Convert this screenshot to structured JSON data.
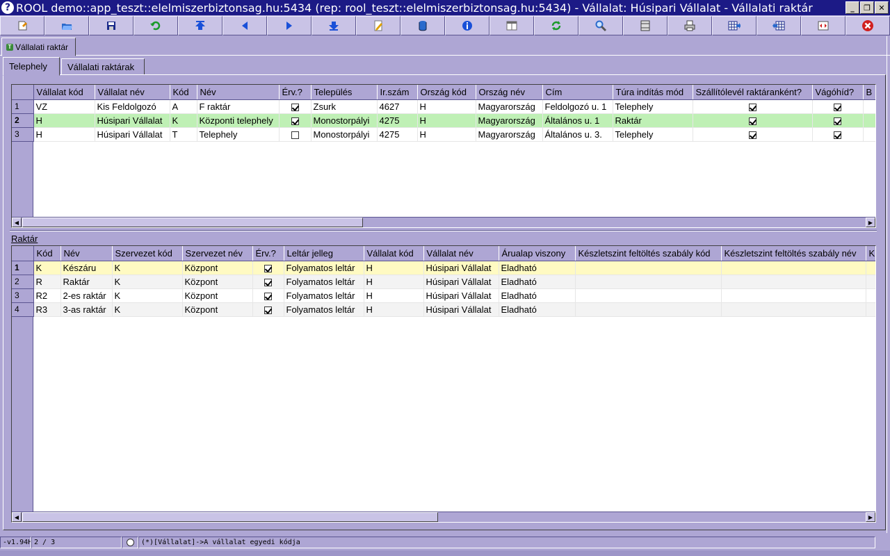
{
  "window": {
    "title": "ROOL demo::app_teszt::elelmiszerbiztonsag.hu:5434 (rep: rool_teszt::elelmiszerbiztonsag.hu:5434) - Vállalat: Húsipari Vállalat - Vállalati raktár",
    "app_icon_glyph": "?",
    "minimize": "_",
    "restore": "❐",
    "close": "✕"
  },
  "toolbar": {
    "buttons": [
      {
        "name": "new-icon",
        "color": "#e08a00"
      },
      {
        "name": "open-folder-icon",
        "color": "#2a6acc"
      },
      {
        "name": "save-icon",
        "color": "#1a2a8a"
      },
      {
        "name": "undo-icon",
        "color": "#1a9a2a"
      },
      {
        "name": "first-record-icon",
        "color": "#1a50d8"
      },
      {
        "name": "previous-record-icon",
        "color": "#1a50d8"
      },
      {
        "name": "next-record-icon",
        "color": "#1a50d8"
      },
      {
        "name": "last-record-icon",
        "color": "#1a50d8"
      },
      {
        "name": "edit-icon",
        "color": "#e0a000"
      },
      {
        "name": "database-icon",
        "color": "#2a6acc"
      },
      {
        "name": "info-icon",
        "color": "#1a50d8"
      },
      {
        "name": "form-view-icon",
        "color": "#6a6a6a"
      },
      {
        "name": "refresh-icon",
        "color": "#1a9a2a"
      },
      {
        "name": "search-icon",
        "color": "#2a6acc"
      },
      {
        "name": "columns-icon",
        "color": "#404040"
      },
      {
        "name": "print-icon",
        "color": "#404040"
      },
      {
        "name": "grid-export-icon",
        "color": "#1a2a8a"
      },
      {
        "name": "grid-import-icon",
        "color": "#1a2a8a"
      },
      {
        "name": "fullscreen-icon",
        "color": "#d02020"
      },
      {
        "name": "close-icon",
        "color": "#d02020"
      }
    ]
  },
  "top_tab": {
    "label": "Vállalati raktár",
    "icon_glyph": "T"
  },
  "sub_tabs": [
    {
      "label": "Telephely",
      "active": true
    },
    {
      "label": "Vállalati raktárak",
      "active": false
    }
  ],
  "telephely_grid": {
    "columns": [
      "Vállalat kód",
      "Vállalat név",
      "Kód",
      "Név",
      "Érv.?",
      "Település",
      "Ir.szám",
      "Ország kód",
      "Ország név",
      "Cím",
      "Túra indítás mód",
      "Szállítólevél raktáranként?",
      "Vágóhíd?",
      "B"
    ],
    "rows": [
      {
        "num": "1",
        "cells": [
          "VZ",
          "Kis Feldolgozó",
          "A",
          "F raktár",
          true,
          "Zsurk",
          "4627",
          "H",
          "Magyarország",
          "Feldolgozó u. 1",
          "Telephely",
          true,
          true
        ]
      },
      {
        "num": "2",
        "cells": [
          "H",
          "Húsipari Vállalat",
          "K",
          "Központi telephely",
          true,
          "Monostorpályi",
          "4275",
          "H",
          "Magyarország",
          "Általános u. 1",
          "Raktár",
          true,
          true
        ],
        "selected": true
      },
      {
        "num": "3",
        "cells": [
          "H",
          "Húsipari Vállalat",
          "T",
          "Telephely",
          false,
          "Monostorpályi",
          "4275",
          "H",
          "Magyarország",
          "Általános u. 3.",
          "Telephely",
          true,
          true
        ]
      }
    ]
  },
  "raktar_section": {
    "label": "Raktár"
  },
  "raktar_grid": {
    "columns": [
      "Kód",
      "Név",
      "Szervezet kód",
      "Szervezet név",
      "Érv.?",
      "Leltár jelleg",
      "Vállalat kód",
      "Vállalat név",
      "Árualap viszony",
      "Készletszint feltöltés szabály kód",
      "Készletszint feltöltés szabály név",
      "K"
    ],
    "rows": [
      {
        "num": "1",
        "cells": [
          "K",
          "Készáru",
          "K",
          "Központ",
          true,
          "Folyamatos leltár",
          "H",
          "Húsipari Vállalat",
          "Eladható",
          "",
          ""
        ],
        "selected": true
      },
      {
        "num": "2",
        "cells": [
          "R",
          "Raktár",
          "K",
          "Központ",
          true,
          "Folyamatos leltár",
          "H",
          "Húsipari Vállalat",
          "Eladható",
          "",
          ""
        ]
      },
      {
        "num": "3",
        "cells": [
          "R2",
          "2-es raktár",
          "K",
          "Központ",
          true,
          "Folyamatos leltár",
          "H",
          "Húsipari Vállalat",
          "Eladható",
          "",
          ""
        ]
      },
      {
        "num": "4",
        "cells": [
          "R3",
          "3-as raktár",
          "K",
          "Központ",
          true,
          "Folyamatos leltár",
          "H",
          "Húsipari Vállalat",
          "Eladható",
          "",
          ""
        ]
      }
    ]
  },
  "statusbar": {
    "version": "-v1.94H",
    "position": "2 / 3",
    "hint": "(*)[Vállalat]->A vállalat egyedi kódja"
  }
}
